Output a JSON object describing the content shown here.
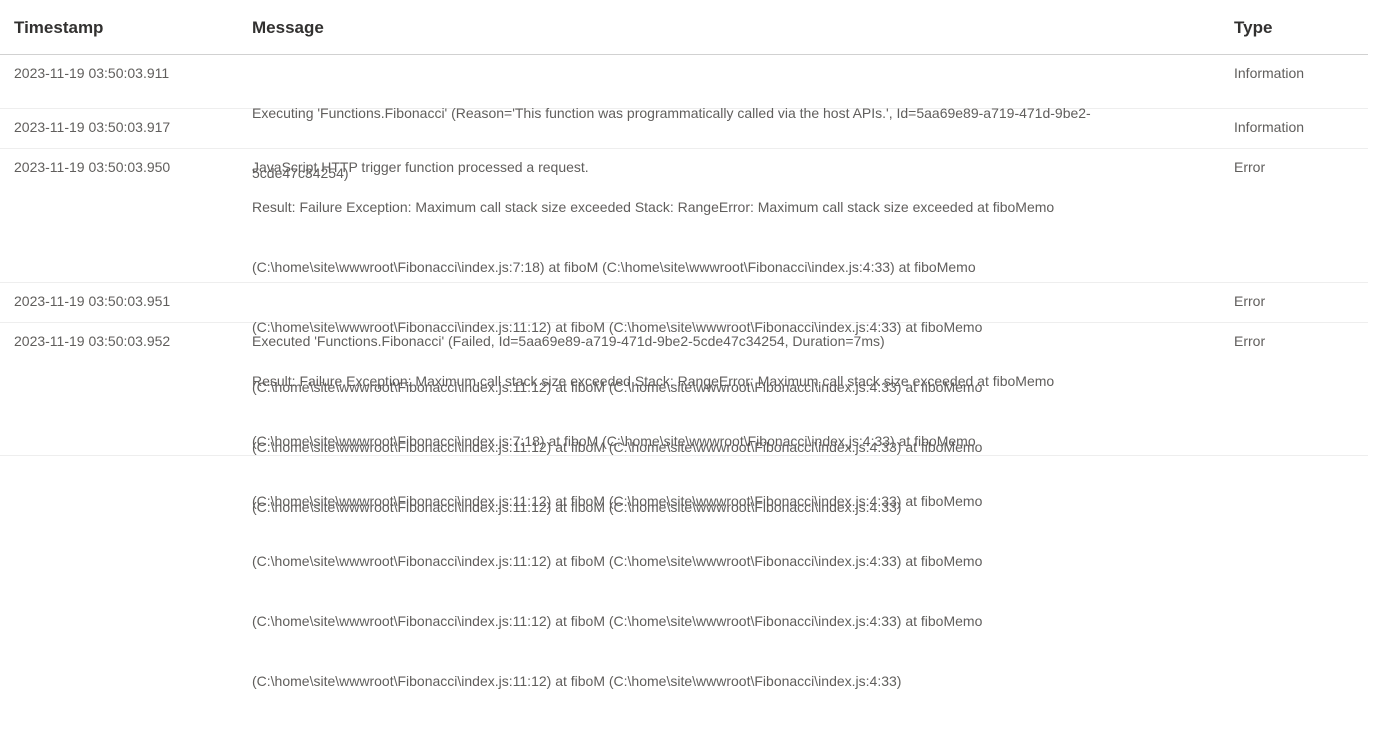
{
  "columns": {
    "timestamp": "Timestamp",
    "message": "Message",
    "type": "Type"
  },
  "rows": [
    {
      "timestamp": "2023-11-19 03:50:03.911",
      "message_lines": [
        "Executing 'Functions.Fibonacci' (Reason='This function was programmatically called via the host APIs.', Id=5aa69e89-a719-471d-9be2-",
        "5cde47c34254)"
      ],
      "type": "Information"
    },
    {
      "timestamp": "2023-11-19 03:50:03.917",
      "message_lines": [
        "JavaScript HTTP trigger function processed a request."
      ],
      "type": "Information"
    },
    {
      "timestamp": "2023-11-19 03:50:03.950",
      "message_lines": [
        "Result: Failure Exception: Maximum call stack size exceeded Stack: RangeError: Maximum call stack size exceeded at fiboMemo",
        "(C:\\home\\site\\wwwroot\\Fibonacci\\index.js:7:18) at fiboM (C:\\home\\site\\wwwroot\\Fibonacci\\index.js:4:33) at fiboMemo",
        "(C:\\home\\site\\wwwroot\\Fibonacci\\index.js:11:12) at fiboM (C:\\home\\site\\wwwroot\\Fibonacci\\index.js:4:33) at fiboMemo",
        "(C:\\home\\site\\wwwroot\\Fibonacci\\index.js:11:12) at fiboM (C:\\home\\site\\wwwroot\\Fibonacci\\index.js:4:33) at fiboMemo",
        "(C:\\home\\site\\wwwroot\\Fibonacci\\index.js:11:12) at fiboM (C:\\home\\site\\wwwroot\\Fibonacci\\index.js:4:33) at fiboMemo",
        "(C:\\home\\site\\wwwroot\\Fibonacci\\index.js:11:12) at fiboM (C:\\home\\site\\wwwroot\\Fibonacci\\index.js:4:33)"
      ],
      "type": "Error"
    },
    {
      "timestamp": "2023-11-19 03:50:03.951",
      "message_lines": [
        "Executed 'Functions.Fibonacci' (Failed, Id=5aa69e89-a719-471d-9be2-5cde47c34254, Duration=7ms)"
      ],
      "type": "Error"
    },
    {
      "timestamp": "2023-11-19 03:50:03.952",
      "message_lines": [
        "Result: Failure Exception: Maximum call stack size exceeded Stack: RangeError: Maximum call stack size exceeded at fiboMemo",
        "(C:\\home\\site\\wwwroot\\Fibonacci\\index.js:7:18) at fiboM (C:\\home\\site\\wwwroot\\Fibonacci\\index.js:4:33) at fiboMemo",
        "(C:\\home\\site\\wwwroot\\Fibonacci\\index.js:11:12) at fiboM (C:\\home\\site\\wwwroot\\Fibonacci\\index.js:4:33) at fiboMemo",
        "(C:\\home\\site\\wwwroot\\Fibonacci\\index.js:11:12) at fiboM (C:\\home\\site\\wwwroot\\Fibonacci\\index.js:4:33) at fiboMemo",
        "(C:\\home\\site\\wwwroot\\Fibonacci\\index.js:11:12) at fiboM (C:\\home\\site\\wwwroot\\Fibonacci\\index.js:4:33) at fiboMemo",
        "(C:\\home\\site\\wwwroot\\Fibonacci\\index.js:11:12) at fiboM (C:\\home\\site\\wwwroot\\Fibonacci\\index.js:4:33)"
      ],
      "type": "Error"
    }
  ]
}
